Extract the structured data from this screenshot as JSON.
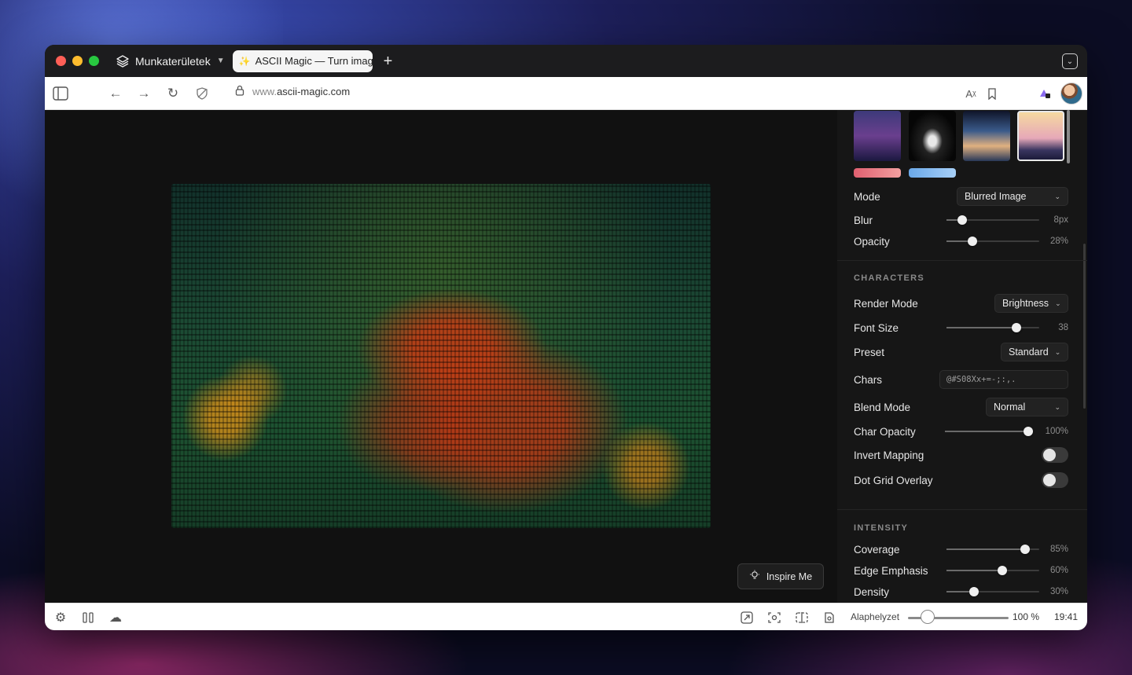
{
  "browser": {
    "workspace_name": "Munkaterületek",
    "tab_title": "ASCII Magic — Turn image",
    "new_tab_symbol": "+",
    "url_prefix": "www.",
    "url_host": "ascii-magic.com"
  },
  "panel": {
    "background": {
      "mode_label": "Mode",
      "mode_value": "Blurred Image",
      "blur_label": "Blur",
      "blur_value": "8px",
      "blur_level": 0.17,
      "opacity_label": "Opacity",
      "opacity_value": "28%",
      "opacity_level": 0.28
    },
    "characters": {
      "section_title": "CHARACTERS",
      "render_mode_label": "Render Mode",
      "render_mode_value": "Brightness",
      "font_size_label": "Font Size",
      "font_size_value": "38",
      "font_size_level": 0.75,
      "preset_label": "Preset",
      "preset_value": "Standard",
      "chars_label": "Chars",
      "chars_value": "@#S08Xx+=-;:,.",
      "blend_mode_label": "Blend Mode",
      "blend_mode_value": "Normal",
      "char_opacity_label": "Char Opacity",
      "char_opacity_value": "100%",
      "char_opacity_level": 1.0,
      "invert_label": "Invert Mapping",
      "invert_on": false,
      "dot_grid_label": "Dot Grid Overlay",
      "dot_grid_on": false
    },
    "intensity": {
      "section_title": "INTENSITY",
      "coverage_label": "Coverage",
      "coverage_value": "85%",
      "coverage_level": 0.85,
      "edge_label": "Edge Emphasis",
      "edge_value": "60%",
      "edge_level": 0.6,
      "density_label": "Density",
      "density_value": "30%",
      "density_level": 0.3
    }
  },
  "canvas": {
    "inspire_label": "Inspire Me"
  },
  "statusbar": {
    "zoom_label": "Alaphelyzet",
    "zoom_value": "100 %",
    "time": "19:41"
  },
  "colors": {
    "accent_red": "#ff5f57",
    "accent_yellow": "#febc2e",
    "accent_green": "#28c840",
    "panel_bg": "#161616"
  }
}
